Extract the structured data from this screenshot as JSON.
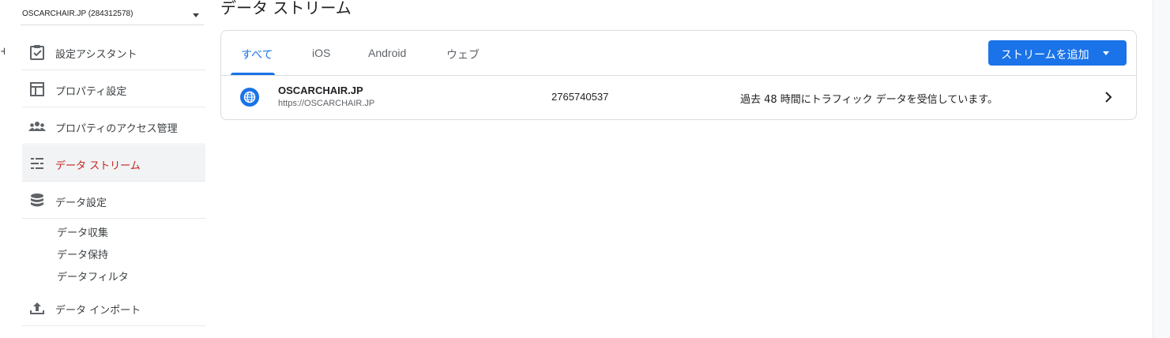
{
  "window": {
    "left_edge_glyph": "+"
  },
  "property_selector": {
    "label": "OSCARCHAIR.JP (284312578)",
    "caret_icon": "dropdown-caret-icon"
  },
  "sidebar": {
    "items": [
      {
        "label": "設定アシスタント",
        "icon": "checklist-icon"
      },
      {
        "label": "プロパティ設定",
        "icon": "layout-icon"
      },
      {
        "label": "プロパティのアクセス管理",
        "icon": "people-icon"
      },
      {
        "label": "データ ストリーム",
        "icon": "data-streams-icon",
        "active": true
      },
      {
        "label": "データ設定",
        "icon": "database-icon"
      }
    ],
    "subitems": [
      {
        "label": "データ収集"
      },
      {
        "label": "データ保持"
      },
      {
        "label": "データフィルタ"
      }
    ],
    "import": {
      "label": "データ インポート",
      "icon": "upload-icon"
    }
  },
  "page": {
    "title": "データ ストリーム"
  },
  "tabs": [
    {
      "label": "すべて",
      "active": true
    },
    {
      "label": "iOS"
    },
    {
      "label": "Android"
    },
    {
      "label": "ウェブ"
    }
  ],
  "add_stream_button": {
    "label": "ストリームを追加"
  },
  "streams": [
    {
      "name": "OSCARCHAIR.JP",
      "url": "https://OSCARCHAIR.JP",
      "id": "2765740537",
      "status": "過去 48 時間にトラフィック データを受信しています。",
      "icon": "globe-icon"
    }
  ],
  "colors": {
    "accent": "#1a73e8",
    "active_nav_text": "#c5221f",
    "active_nav_bg": "#f1f3f4",
    "border": "#dadce0",
    "icon_gray": "#5f6368"
  }
}
